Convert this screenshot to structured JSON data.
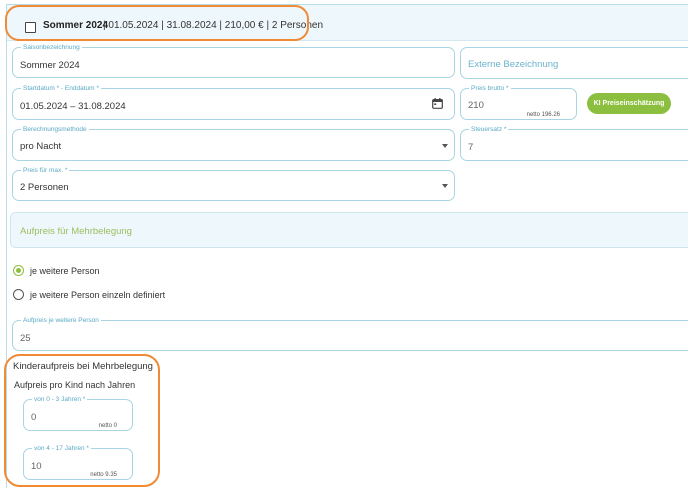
{
  "header": {
    "title": "Sommer 2024",
    "summary": "| 01.05.2024 | 31.08.2024 | 210,00 € | 2 Personen"
  },
  "fields": {
    "saisonbezeichnung": {
      "label": "Saisonbezeichnung",
      "value": "Sommer 2024"
    },
    "externe": {
      "placeholder": "Externe Bezeichnung"
    },
    "datum": {
      "label": "Startdatum * - Enddatum *",
      "value": "01.05.2024 – 31.08.2024"
    },
    "preis": {
      "label": "Preis brutto *",
      "value": "210",
      "netto": "netto 196.26"
    },
    "berechnung": {
      "label": "Berechnungsmethode",
      "value": "pro Nacht"
    },
    "steuersatz": {
      "label": "Steuersatz *",
      "value": "7"
    },
    "preis_max": {
      "label": "Preis für max. *",
      "value": "2 Personen"
    },
    "aufpreis_person": {
      "label": "Aufpreis je weitere Person",
      "value": "25"
    },
    "kind_0_3": {
      "label": "von 0 - 3 Jahren *",
      "value": "0",
      "netto": "netto 0"
    },
    "kind_4_17": {
      "label": "von 4 - 17 Jahren *",
      "value": "10",
      "netto": "netto 9.35"
    }
  },
  "buttons": {
    "ki": "KI Preiseinschätzung"
  },
  "mehrbelegung": {
    "title": "Aufpreis für Mehrbelegung",
    "options": [
      "je weitere Person",
      "je weitere Person einzeln definiert"
    ],
    "selected": 0
  },
  "kinder": {
    "heading": "Kinderaufpreis bei Mehrbelegung",
    "subheading": "Aufpreis pro Kind nach Jahren"
  },
  "colors": {
    "accent": "#8cbf3f",
    "border": "#a9d4e3",
    "highlight": "#f08a35",
    "label": "#5aa9c6"
  }
}
